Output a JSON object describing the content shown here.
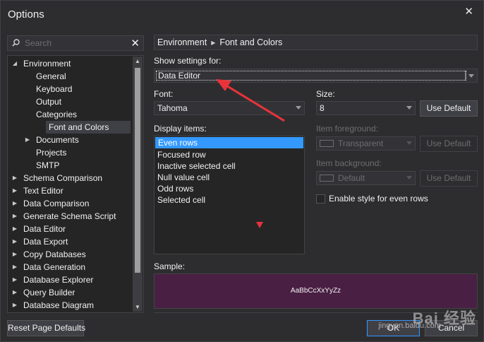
{
  "window": {
    "title": "Options",
    "close_glyph": "✕"
  },
  "search": {
    "placeholder": "Search",
    "clear_glyph": "✕"
  },
  "tree": {
    "items": [
      {
        "label": "Environment",
        "level": 0,
        "arrow": "◢",
        "selected": false
      },
      {
        "label": "General",
        "level": 1,
        "arrow": "",
        "selected": false
      },
      {
        "label": "Keyboard",
        "level": 1,
        "arrow": "",
        "selected": false
      },
      {
        "label": "Output",
        "level": 1,
        "arrow": "",
        "selected": false
      },
      {
        "label": "Categories",
        "level": 1,
        "arrow": "",
        "selected": false
      },
      {
        "label": "Font and Colors",
        "level": 1,
        "arrow": "",
        "selected": true
      },
      {
        "label": "Documents",
        "level": 1,
        "arrow": "▶",
        "selected": false
      },
      {
        "label": "Projects",
        "level": 1,
        "arrow": "",
        "selected": false
      },
      {
        "label": "SMTP",
        "level": 1,
        "arrow": "",
        "selected": false
      },
      {
        "label": "Schema Comparison",
        "level": 0,
        "arrow": "▶",
        "selected": false
      },
      {
        "label": "Text Editor",
        "level": 0,
        "arrow": "▶",
        "selected": false
      },
      {
        "label": "Data Comparison",
        "level": 0,
        "arrow": "▶",
        "selected": false
      },
      {
        "label": "Generate Schema Script",
        "level": 0,
        "arrow": "▶",
        "selected": false
      },
      {
        "label": "Data Editor",
        "level": 0,
        "arrow": "▶",
        "selected": false
      },
      {
        "label": "Data Export",
        "level": 0,
        "arrow": "▶",
        "selected": false
      },
      {
        "label": "Copy Databases",
        "level": 0,
        "arrow": "▶",
        "selected": false
      },
      {
        "label": "Data Generation",
        "level": 0,
        "arrow": "▶",
        "selected": false
      },
      {
        "label": "Database Explorer",
        "level": 0,
        "arrow": "▶",
        "selected": false
      },
      {
        "label": "Query Builder",
        "level": 0,
        "arrow": "▶",
        "selected": false
      },
      {
        "label": "Database Diagram",
        "level": 0,
        "arrow": "▶",
        "selected": false
      }
    ]
  },
  "breadcrumb": {
    "part1": "Environment",
    "part2": "Font and Colors"
  },
  "show_settings": {
    "label": "Show settings for:",
    "value": "Data Editor"
  },
  "font": {
    "label": "Font:",
    "value": "Tahoma"
  },
  "size": {
    "label": "Size:",
    "value": "8",
    "use_default": "Use Default"
  },
  "display_items": {
    "label": "Display items:",
    "items": [
      "Even rows",
      "Focused row",
      "Inactive selected cell",
      "Null value cell",
      "Odd rows",
      "Selected cell"
    ],
    "selected_index": 0
  },
  "foreground": {
    "label": "Item foreground:",
    "value": "Transparent",
    "use_default": "Use Default"
  },
  "background": {
    "label": "Item background:",
    "value": "Default",
    "use_default": "Use Default"
  },
  "enable_style": {
    "label": "Enable style for even rows",
    "checked": false
  },
  "sample": {
    "label": "Sample:",
    "text": "AaBbCcXxYyZz",
    "background_color": "#4a1f44"
  },
  "footer": {
    "reset": "Reset Page Defaults",
    "ok": "OK",
    "cancel": "Cancel"
  },
  "colors": {
    "accent": "#3399ff",
    "annotation": "#e8333a"
  },
  "watermark": {
    "brand": "Bai 经验",
    "url": "jingyan.baidu.com"
  }
}
